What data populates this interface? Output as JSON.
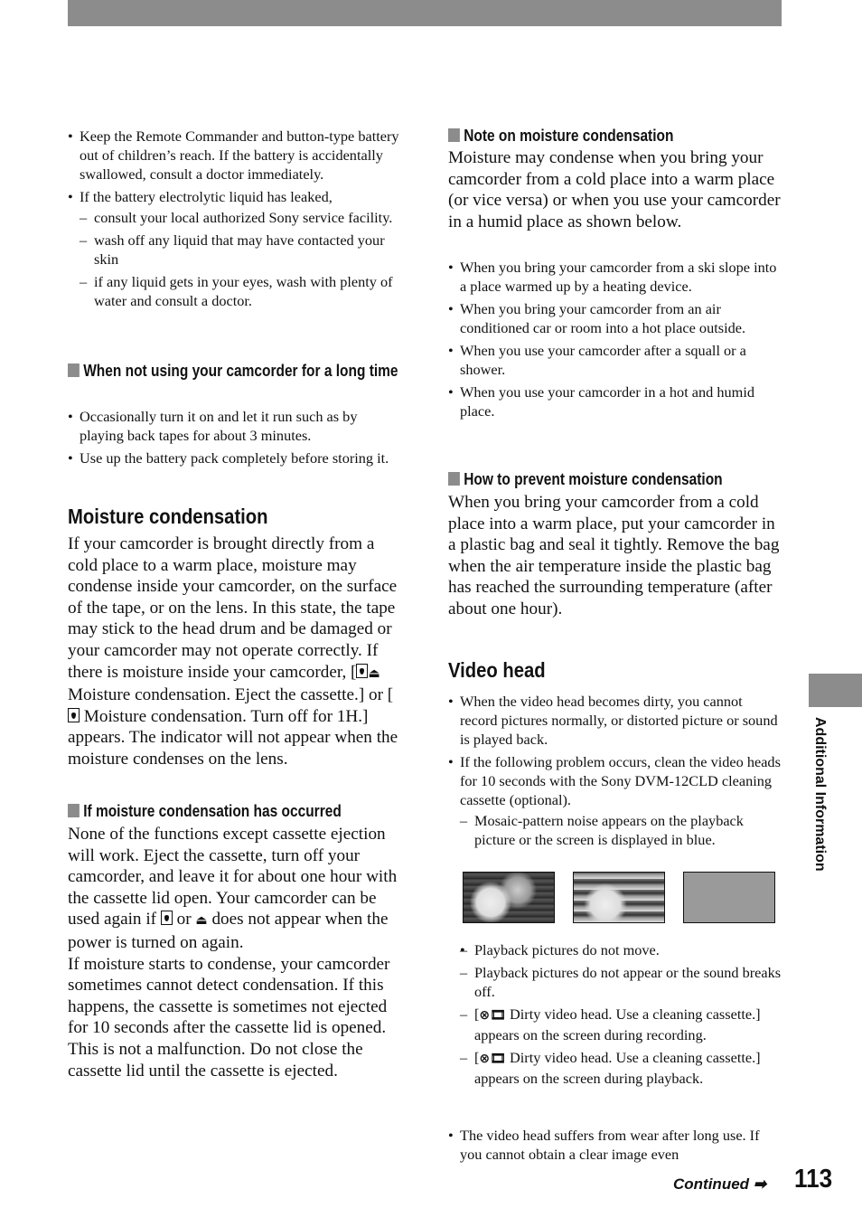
{
  "left": {
    "bullets1": [
      {
        "text": "Keep the Remote Commander and button-type battery out of children’s reach. If the battery is accidentally swallowed, consult a doctor immediately."
      },
      {
        "text": "If the battery electrolytic liquid has leaked,",
        "sub": [
          "consult your local authorized Sony service facility.",
          "wash off any liquid that may have contacted your skin",
          "if any liquid gets in your eyes, wash with plenty of water and consult a doctor."
        ]
      }
    ],
    "h_not_using": "When not using your camcorder for a long time",
    "bullets2": [
      "Occasionally turn it on and let it run such as by playing back tapes for about 3 minutes.",
      "Use up the battery pack completely before storing it."
    ],
    "h_moisture": "Moisture condensation",
    "moisture_p1": "If your camcorder is brought directly from a cold place to a warm place, moisture may condense inside your camcorder, on the surface of the tape, or on the lens. In this state, the tape may stick to the head drum and be damaged or your camcorder may not operate correctly. If there is moisture inside your camcorder, [",
    "moisture_p2": " Moisture condensation. Eject the cassette.] or [",
    "moisture_p3": " Moisture condensation. Turn off for 1H.] appears. The indicator will not appear when the moisture condenses on the lens.",
    "h_occurred": "If moisture condensation has occurred",
    "occurred_p1": "None of the functions except cassette ejection will work. Eject the cassette, turn off your camcorder, and leave it for about one hour with the cassette lid open. Your camcorder can be used again if ",
    "occurred_or": " or ",
    "occurred_p2": " does not appear when the power is turned on again.",
    "occurred_p3": "If moisture starts to condense, your camcorder sometimes cannot detect condensation. If this happens, the cassette is sometimes not ejected for 10 seconds after the cassette lid is opened. This is not a malfunction. Do not close the cassette lid until the cassette is ejected."
  },
  "right": {
    "h_note": "Note on moisture condensation",
    "note_p": "Moisture may condense when you bring your camcorder from a cold place into a warm place (or vice versa) or when you use your camcorder in a humid place as shown below.",
    "note_bullets": [
      "When you bring your camcorder from a ski slope into a place warmed up by a heating device.",
      "When you bring your camcorder from an air conditioned car or room into a hot place outside.",
      "When you use your camcorder after a squall or a shower.",
      "When you use your camcorder in a hot and humid place."
    ],
    "h_prevent": "How to prevent moisture condensation",
    "prevent_p": "When you bring your camcorder from a cold place into a warm place, put your camcorder in a plastic bag and seal it tightly. Remove the bag when the air temperature inside the plastic bag has reached the surrounding temperature (after about one hour).",
    "h_video": "Video head",
    "video_b1": "When the video head becomes dirty, you cannot record pictures normally, or distorted picture or sound is played back.",
    "video_b2": "If the following problem occurs, clean the video heads for 10 seconds with the Sony DVM-12CLD cleaning cassette (optional).",
    "video_sub1": "Mosaic-pattern noise appears on the playback picture or the screen is displayed in blue.",
    "video_sub2": [
      "Playback pictures do not move.",
      "Playback pictures do not appear or the sound breaks off."
    ],
    "dirty_rec": " Dirty video head. Use a cleaning cassette.] appears on the screen during recording.",
    "dirty_play": " Dirty video head. Use a cleaning cassette.] appears on the screen during playback.",
    "bracket": "[",
    "video_b3": "The video head suffers from wear after long use. If you cannot obtain a clear image even"
  },
  "side_tab": "Additional Information",
  "footer": {
    "continued": "Continued",
    "arrow": "➡",
    "page": "113"
  },
  "icons": {
    "moisture": "droplet-box-icon",
    "eject": "⏏",
    "dirty_head": "⊗🎞"
  }
}
